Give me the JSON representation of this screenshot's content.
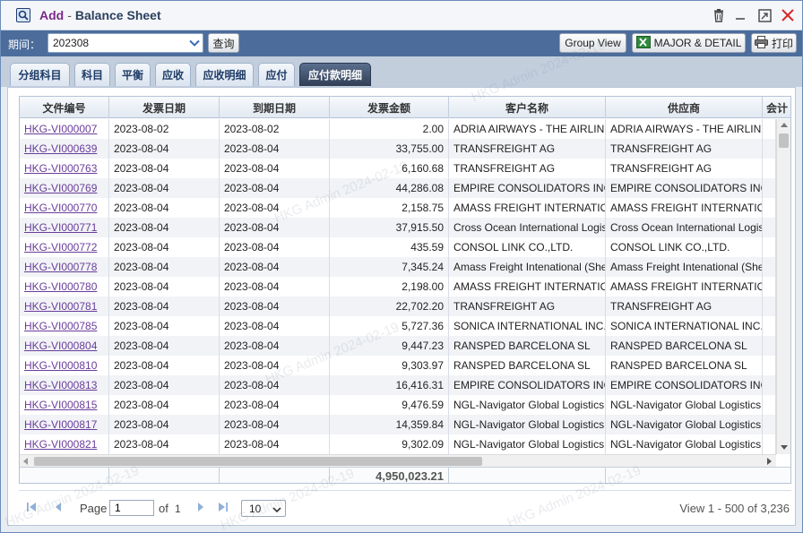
{
  "window": {
    "title_accent": "Add",
    "title_sep": "-",
    "title": "Balance Sheet"
  },
  "toolbar": {
    "period_label": "期间：",
    "period_value": "202308",
    "query_label": "查询",
    "group_view_label": "Group View",
    "major_detail_label": "MAJOR & DETAIL",
    "print_label": "打印"
  },
  "tabs": [
    {
      "label": "分组科目",
      "active": false
    },
    {
      "label": "科目",
      "active": false
    },
    {
      "label": "平衡",
      "active": false
    },
    {
      "label": "应收",
      "active": false
    },
    {
      "label": "应收明细",
      "active": false
    },
    {
      "label": "应付",
      "active": false
    },
    {
      "label": "应付款明细",
      "active": true
    }
  ],
  "grid": {
    "columns": [
      "文件编号",
      "发票日期",
      "到期日期",
      "发票金额",
      "客户名称",
      "供应商",
      "会计"
    ],
    "rows": [
      [
        "HKG-VI000007",
        "2023-08-02",
        "2023-08-02",
        "2.00",
        "ADRIA AIRWAYS - THE AIRLIN",
        "ADRIA AIRWAYS - THE AIRLIN"
      ],
      [
        "HKG-VI000639",
        "2023-08-04",
        "2023-08-04",
        "33,755.00",
        "TRANSFREIGHT AG",
        "TRANSFREIGHT AG"
      ],
      [
        "HKG-VI000763",
        "2023-08-04",
        "2023-08-04",
        "6,160.68",
        "TRANSFREIGHT AG",
        "TRANSFREIGHT AG"
      ],
      [
        "HKG-VI000769",
        "2023-08-04",
        "2023-08-04",
        "44,286.08",
        "EMPIRE CONSOLIDATORS INC",
        "EMPIRE CONSOLIDATORS INC"
      ],
      [
        "HKG-VI000770",
        "2023-08-04",
        "2023-08-04",
        "2,158.75",
        "AMASS FREIGHT INTERNATIO",
        "AMASS FREIGHT INTERNATIO"
      ],
      [
        "HKG-VI000771",
        "2023-08-04",
        "2023-08-04",
        "37,915.50",
        "Cross Ocean International Logis",
        "Cross Ocean International Logis"
      ],
      [
        "HKG-VI000772",
        "2023-08-04",
        "2023-08-04",
        "435.59",
        "CONSOL LINK CO.,LTD.",
        "CONSOL LINK CO.,LTD."
      ],
      [
        "HKG-VI000778",
        "2023-08-04",
        "2023-08-04",
        "7,345.24",
        "Amass Freight Intenational (She",
        "Amass Freight Intenational (She"
      ],
      [
        "HKG-VI000780",
        "2023-08-04",
        "2023-08-04",
        "2,198.00",
        "AMASS FREIGHT INTERNATIO",
        "AMASS FREIGHT INTERNATIO"
      ],
      [
        "HKG-VI000781",
        "2023-08-04",
        "2023-08-04",
        "22,702.20",
        "TRANSFREIGHT AG",
        "TRANSFREIGHT AG"
      ],
      [
        "HKG-VI000785",
        "2023-08-04",
        "2023-08-04",
        "5,727.36",
        "SONICA INTERNATIONAL INC.",
        "SONICA INTERNATIONAL INC."
      ],
      [
        "HKG-VI000804",
        "2023-08-04",
        "2023-08-04",
        "9,447.23",
        "RANSPED BARCELONA SL",
        "RANSPED BARCELONA SL"
      ],
      [
        "HKG-VI000810",
        "2023-08-04",
        "2023-08-04",
        "9,303.97",
        "RANSPED BARCELONA SL",
        "RANSPED BARCELONA SL"
      ],
      [
        "HKG-VI000813",
        "2023-08-04",
        "2023-08-04",
        "16,416.31",
        "EMPIRE CONSOLIDATORS INC",
        "EMPIRE CONSOLIDATORS INC"
      ],
      [
        "HKG-VI000815",
        "2023-08-04",
        "2023-08-04",
        "9,476.59",
        "NGL-Navigator Global Logistics",
        "NGL-Navigator Global Logistics"
      ],
      [
        "HKG-VI000817",
        "2023-08-04",
        "2023-08-04",
        "14,359.84",
        "NGL-Navigator Global Logistics",
        "NGL-Navigator Global Logistics"
      ],
      [
        "HKG-VI000821",
        "2023-08-04",
        "2023-08-04",
        "9,302.09",
        "NGL-Navigator Global Logistics",
        "NGL-Navigator Global Logistics"
      ]
    ],
    "total_amount": "4,950,023.21"
  },
  "pager": {
    "page_label": "Page",
    "page_value": "1",
    "of_label": "of",
    "total_pages": "1",
    "page_size": "10",
    "view_text": "View 1 - 500 of 3,236"
  },
  "watermark": "HKG Admin 2024-02-19",
  "colors": {
    "toolbar_bg": "#4c6d9c",
    "link": "#6a3d9a",
    "active_tab": "#303e55",
    "title_accent": "#7a2a8a"
  }
}
